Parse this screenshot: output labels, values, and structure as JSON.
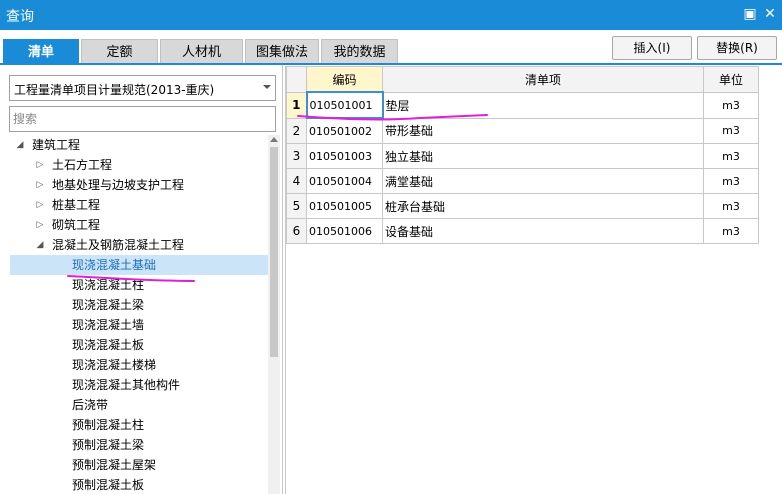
{
  "window": {
    "title": "查询",
    "controls": [
      {
        "name": "restore",
        "glyph": "▣"
      },
      {
        "name": "close",
        "glyph": "✕"
      }
    ]
  },
  "tabs": [
    {
      "label": "清单",
      "active": true
    },
    {
      "label": "定额",
      "active": false
    },
    {
      "label": "人材机",
      "active": false
    },
    {
      "label": "图集做法",
      "active": false
    },
    {
      "label": "我的数据",
      "active": false
    }
  ],
  "buttons": {
    "insert": "插入(I)",
    "replace": "替换(R)"
  },
  "left": {
    "spec_select": "工程量清单项目计量规范(2013-重庆)",
    "search_placeholder": "搜索",
    "tree": [
      {
        "label": "建筑工程",
        "level": 0,
        "arrow": "◢",
        "selected": false
      },
      {
        "label": "土石方工程",
        "level": 1,
        "arrow": "▷",
        "selected": false
      },
      {
        "label": "地基处理与边坡支护工程",
        "level": 1,
        "arrow": "▷",
        "selected": false
      },
      {
        "label": "桩基工程",
        "level": 1,
        "arrow": "▷",
        "selected": false
      },
      {
        "label": "砌筑工程",
        "level": 1,
        "arrow": "▷",
        "selected": false
      },
      {
        "label": "混凝土及钢筋混凝土工程",
        "level": 1,
        "arrow": "◢",
        "selected": false
      },
      {
        "label": "现浇混凝土基础",
        "level": 2,
        "arrow": "",
        "selected": true
      },
      {
        "label": "现浇混凝土柱",
        "level": 2,
        "arrow": "",
        "selected": false
      },
      {
        "label": "现浇混凝土梁",
        "level": 2,
        "arrow": "",
        "selected": false
      },
      {
        "label": "现浇混凝土墙",
        "level": 2,
        "arrow": "",
        "selected": false
      },
      {
        "label": "现浇混凝土板",
        "level": 2,
        "arrow": "",
        "selected": false
      },
      {
        "label": "现浇混凝土楼梯",
        "level": 2,
        "arrow": "",
        "selected": false
      },
      {
        "label": "现浇混凝土其他构件",
        "level": 2,
        "arrow": "",
        "selected": false
      },
      {
        "label": "后浇带",
        "level": 2,
        "arrow": "",
        "selected": false
      },
      {
        "label": "预制混凝土柱",
        "level": 2,
        "arrow": "",
        "selected": false
      },
      {
        "label": "预制混凝土梁",
        "level": 2,
        "arrow": "",
        "selected": false
      },
      {
        "label": "预制混凝土屋架",
        "level": 2,
        "arrow": "",
        "selected": false
      },
      {
        "label": "预制混凝土板",
        "level": 2,
        "arrow": "",
        "selected": false
      }
    ]
  },
  "table": {
    "headers": {
      "code": "编码",
      "item": "清单项",
      "unit": "单位"
    },
    "rows": [
      {
        "n": "1",
        "code": "010501001",
        "item": "垫层",
        "unit": "m3"
      },
      {
        "n": "2",
        "code": "010501002",
        "item": "带形基础",
        "unit": "m3"
      },
      {
        "n": "3",
        "code": "010501003",
        "item": "独立基础",
        "unit": "m3"
      },
      {
        "n": "4",
        "code": "010501004",
        "item": "满堂基础",
        "unit": "m3"
      },
      {
        "n": "5",
        "code": "010501005",
        "item": "桩承台基础",
        "unit": "m3"
      },
      {
        "n": "6",
        "code": "010501006",
        "item": "设备基础",
        "unit": "m3"
      }
    ]
  },
  "colors": {
    "accent": "#1a8bd6",
    "annotation": "#e020d8",
    "selected_bg": "#cce4f7",
    "code_header_bg": "#fff6cc"
  }
}
